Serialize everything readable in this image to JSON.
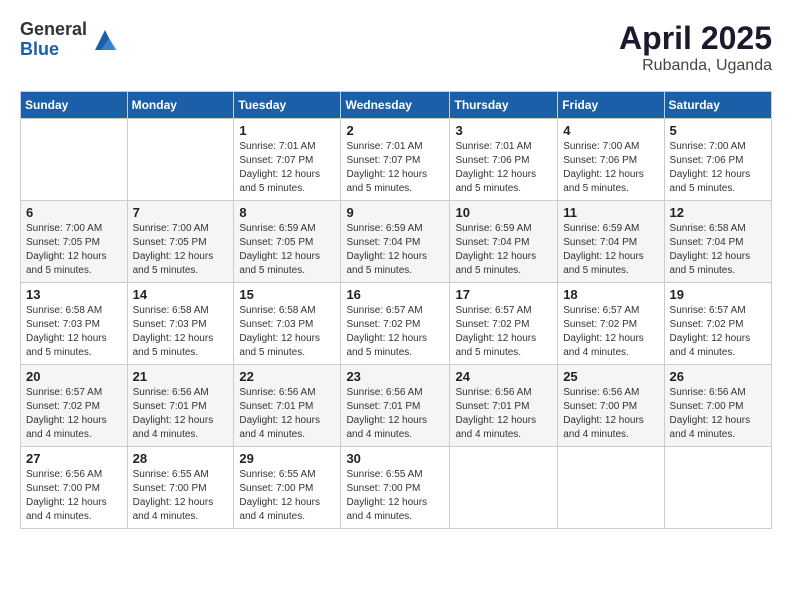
{
  "header": {
    "logo_general": "General",
    "logo_blue": "Blue",
    "month_title": "April 2025",
    "location": "Rubanda, Uganda"
  },
  "days_of_week": [
    "Sunday",
    "Monday",
    "Tuesday",
    "Wednesday",
    "Thursday",
    "Friday",
    "Saturday"
  ],
  "weeks": [
    [
      {
        "day": "",
        "info": ""
      },
      {
        "day": "",
        "info": ""
      },
      {
        "day": "1",
        "info": "Sunrise: 7:01 AM\nSunset: 7:07 PM\nDaylight: 12 hours and 5 minutes."
      },
      {
        "day": "2",
        "info": "Sunrise: 7:01 AM\nSunset: 7:07 PM\nDaylight: 12 hours and 5 minutes."
      },
      {
        "day": "3",
        "info": "Sunrise: 7:01 AM\nSunset: 7:06 PM\nDaylight: 12 hours and 5 minutes."
      },
      {
        "day": "4",
        "info": "Sunrise: 7:00 AM\nSunset: 7:06 PM\nDaylight: 12 hours and 5 minutes."
      },
      {
        "day": "5",
        "info": "Sunrise: 7:00 AM\nSunset: 7:06 PM\nDaylight: 12 hours and 5 minutes."
      }
    ],
    [
      {
        "day": "6",
        "info": "Sunrise: 7:00 AM\nSunset: 7:05 PM\nDaylight: 12 hours and 5 minutes."
      },
      {
        "day": "7",
        "info": "Sunrise: 7:00 AM\nSunset: 7:05 PM\nDaylight: 12 hours and 5 minutes."
      },
      {
        "day": "8",
        "info": "Sunrise: 6:59 AM\nSunset: 7:05 PM\nDaylight: 12 hours and 5 minutes."
      },
      {
        "day": "9",
        "info": "Sunrise: 6:59 AM\nSunset: 7:04 PM\nDaylight: 12 hours and 5 minutes."
      },
      {
        "day": "10",
        "info": "Sunrise: 6:59 AM\nSunset: 7:04 PM\nDaylight: 12 hours and 5 minutes."
      },
      {
        "day": "11",
        "info": "Sunrise: 6:59 AM\nSunset: 7:04 PM\nDaylight: 12 hours and 5 minutes."
      },
      {
        "day": "12",
        "info": "Sunrise: 6:58 AM\nSunset: 7:04 PM\nDaylight: 12 hours and 5 minutes."
      }
    ],
    [
      {
        "day": "13",
        "info": "Sunrise: 6:58 AM\nSunset: 7:03 PM\nDaylight: 12 hours and 5 minutes."
      },
      {
        "day": "14",
        "info": "Sunrise: 6:58 AM\nSunset: 7:03 PM\nDaylight: 12 hours and 5 minutes."
      },
      {
        "day": "15",
        "info": "Sunrise: 6:58 AM\nSunset: 7:03 PM\nDaylight: 12 hours and 5 minutes."
      },
      {
        "day": "16",
        "info": "Sunrise: 6:57 AM\nSunset: 7:02 PM\nDaylight: 12 hours and 5 minutes."
      },
      {
        "day": "17",
        "info": "Sunrise: 6:57 AM\nSunset: 7:02 PM\nDaylight: 12 hours and 5 minutes."
      },
      {
        "day": "18",
        "info": "Sunrise: 6:57 AM\nSunset: 7:02 PM\nDaylight: 12 hours and 4 minutes."
      },
      {
        "day": "19",
        "info": "Sunrise: 6:57 AM\nSunset: 7:02 PM\nDaylight: 12 hours and 4 minutes."
      }
    ],
    [
      {
        "day": "20",
        "info": "Sunrise: 6:57 AM\nSunset: 7:02 PM\nDaylight: 12 hours and 4 minutes."
      },
      {
        "day": "21",
        "info": "Sunrise: 6:56 AM\nSunset: 7:01 PM\nDaylight: 12 hours and 4 minutes."
      },
      {
        "day": "22",
        "info": "Sunrise: 6:56 AM\nSunset: 7:01 PM\nDaylight: 12 hours and 4 minutes."
      },
      {
        "day": "23",
        "info": "Sunrise: 6:56 AM\nSunset: 7:01 PM\nDaylight: 12 hours and 4 minutes."
      },
      {
        "day": "24",
        "info": "Sunrise: 6:56 AM\nSunset: 7:01 PM\nDaylight: 12 hours and 4 minutes."
      },
      {
        "day": "25",
        "info": "Sunrise: 6:56 AM\nSunset: 7:00 PM\nDaylight: 12 hours and 4 minutes."
      },
      {
        "day": "26",
        "info": "Sunrise: 6:56 AM\nSunset: 7:00 PM\nDaylight: 12 hours and 4 minutes."
      }
    ],
    [
      {
        "day": "27",
        "info": "Sunrise: 6:56 AM\nSunset: 7:00 PM\nDaylight: 12 hours and 4 minutes."
      },
      {
        "day": "28",
        "info": "Sunrise: 6:55 AM\nSunset: 7:00 PM\nDaylight: 12 hours and 4 minutes."
      },
      {
        "day": "29",
        "info": "Sunrise: 6:55 AM\nSunset: 7:00 PM\nDaylight: 12 hours and 4 minutes."
      },
      {
        "day": "30",
        "info": "Sunrise: 6:55 AM\nSunset: 7:00 PM\nDaylight: 12 hours and 4 minutes."
      },
      {
        "day": "",
        "info": ""
      },
      {
        "day": "",
        "info": ""
      },
      {
        "day": "",
        "info": ""
      }
    ]
  ]
}
